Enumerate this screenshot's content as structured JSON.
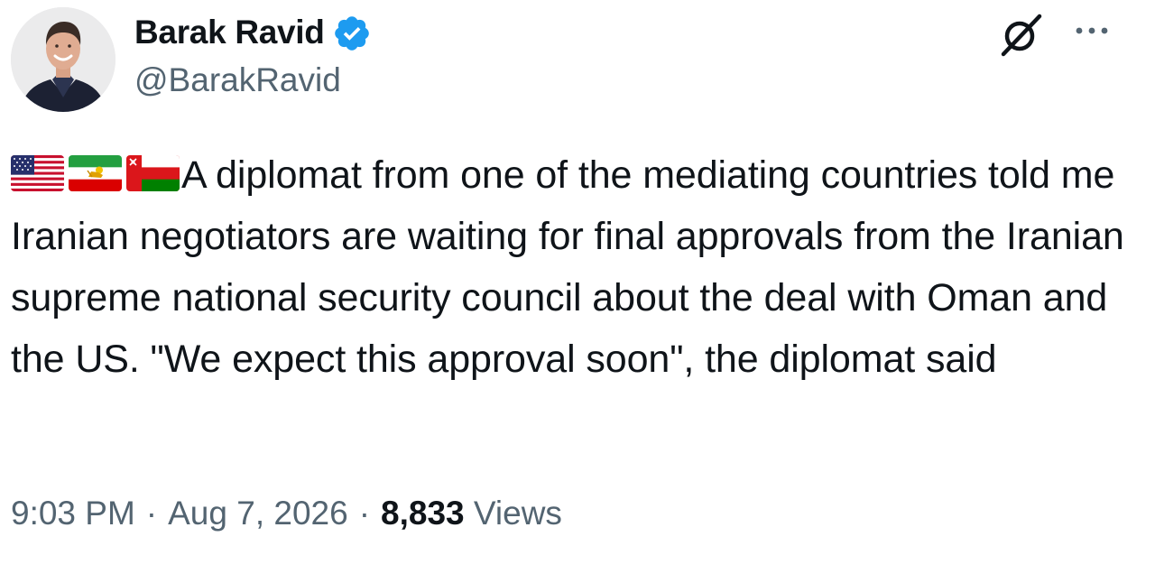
{
  "author": {
    "display_name": "Barak Ravid",
    "handle": "@BarakRavid",
    "verified": true,
    "verified_color": "#1d9bf0"
  },
  "icons": {
    "verified": "verified-badge-icon",
    "grok": "grok-icon",
    "more": "more-options-icon"
  },
  "tweet": {
    "flags": [
      "us-flag-icon",
      "iran-lion-sun-flag-icon",
      "oman-flag-icon"
    ],
    "text": "A diplomat from one of the mediating countries told me Iranian negotiators are waiting for final approvals from the Iranian supreme national security council about the deal with Oman and the US. \"We expect this approval soon\", the diplomat said"
  },
  "meta": {
    "time": "9:03 PM",
    "separator": "·",
    "date": "Aug 7, 2026",
    "views_count": "8,833",
    "views_label": "Views"
  },
  "colors": {
    "text_primary": "#0f1419",
    "text_secondary": "#536471",
    "background": "#ffffff"
  }
}
